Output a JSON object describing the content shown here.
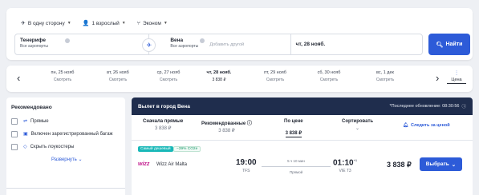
{
  "search": {
    "options": [
      {
        "icon": "plane-icon",
        "label": "В одну сторону"
      },
      {
        "icon": "person-icon",
        "label": "1 взрослый"
      },
      {
        "icon": "seat-icon",
        "label": "Эконом"
      }
    ],
    "from": {
      "city": "Тенерифе",
      "airports": "Все аэропорты"
    },
    "to": {
      "city": "Вена",
      "airports": "Все аэропорты",
      "add_other": "Добавить другой"
    },
    "date": "чт, 28 нояб.",
    "button": "Найти"
  },
  "date_strip": {
    "days": [
      {
        "date": "пн, 25 нояб",
        "price": "Смотреть"
      },
      {
        "date": "вт, 26 нояб",
        "price": "Смотреть"
      },
      {
        "date": "ср, 27 нояб",
        "price": "Смотреть"
      },
      {
        "date": "чт, 28 нояб.",
        "price": "3 838 ₽",
        "active": true
      },
      {
        "date": "пт, 29 нояб",
        "price": "Смотреть"
      },
      {
        "date": "сб, 30 нояб",
        "price": "Смотреть"
      },
      {
        "date": "вс, 1 дек",
        "price": "Смотреть"
      }
    ],
    "price_tab": "Цена"
  },
  "filters": {
    "title": "Рекомендовано",
    "items": [
      {
        "icon": "direct-icon",
        "label": "Прямые"
      },
      {
        "icon": "luggage-icon",
        "label": "Включен зарегистрированный багаж"
      },
      {
        "icon": "tag-icon",
        "label": "Скрыть лоукостеры"
      }
    ],
    "expand": "Развернуть"
  },
  "results": {
    "header_title": "Вылет в город Вена",
    "updated": "*Последнее обновление: 08:30:56",
    "sorts": [
      {
        "name": "Сначала прямые",
        "value": "3 838 ₽"
      },
      {
        "name": "Рекомендованные",
        "value": "3 838 ₽"
      },
      {
        "name": "По цене",
        "value": "3 838 ₽",
        "active": true
      },
      {
        "name": "Сортировать",
        "value": "⌄"
      }
    ],
    "watch": "Следить за ценой",
    "flight": {
      "badge": "Самый дешевый",
      "co2": "−39% CO2e",
      "logo": "wizz",
      "airline": "Wizz Air Malta",
      "dep_time": "19:00",
      "dep_airport": "TFS",
      "duration": "5 ч 10 мин",
      "stops": "Прямой",
      "arr_time": "01:10",
      "arr_plus": "+1",
      "arr_airport": "VIE T3",
      "price": "3 838 ₽",
      "button": "Выбрать"
    }
  }
}
